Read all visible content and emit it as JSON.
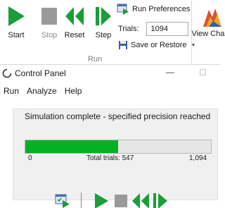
{
  "ribbon": {
    "run_group": {
      "label": "Run",
      "start_label": "Start",
      "stop_label": "Stop",
      "reset_label": "Reset",
      "step_label": "Step",
      "run_preferences_label": "Run Preferences",
      "trials_label": "Trials:",
      "trials_value": "1094",
      "save_or_restore_label": "Save or Restore"
    },
    "view_charts_label": "View Charts"
  },
  "control_panel": {
    "title": "Control Panel",
    "menu": [
      "Run",
      "Analyze",
      "Help"
    ],
    "status_message": "Simulation complete - specified precision reached",
    "progress": {
      "min_label": "0",
      "max_label": "1,094",
      "total_label": "Total trials: 547",
      "fraction": 0.5
    }
  },
  "colors": {
    "green": "#1a9d3a",
    "progress_green": "#06b025",
    "stop_gray": "#8c8c8c"
  }
}
